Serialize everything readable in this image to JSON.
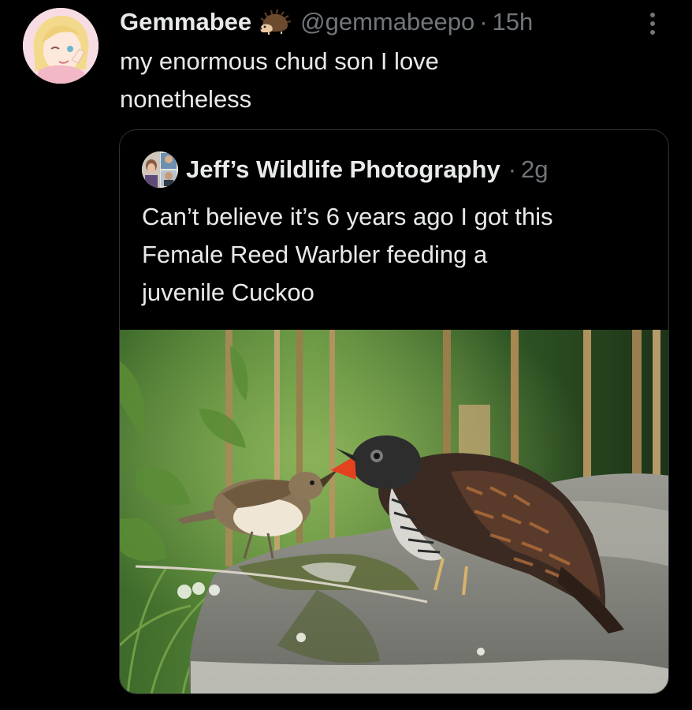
{
  "tweet": {
    "display_name": "Gemmabee",
    "badge_icon": "hedgehog-icon",
    "handle": "@gemmabeepo",
    "separator": "·",
    "timestamp": "15h",
    "text_line1": "my enormous chud son I love",
    "text_line2": "nonetheless"
  },
  "quote": {
    "display_name": "Jeff’s Wildlife Photography",
    "separator": "·",
    "timestamp": "2g",
    "text_line1": "Can’t believe it’s 6 years ago I got this",
    "text_line2": "Female Reed Warbler feeding a",
    "text_line3": "juvenile Cuckoo",
    "photo_subject": "reed warbler feeding juvenile cuckoo on mossy rock"
  },
  "colors": {
    "background": "#000000",
    "primary_text": "#e7e9ea",
    "secondary_text": "#71767b",
    "card_border": "#2f3336"
  }
}
